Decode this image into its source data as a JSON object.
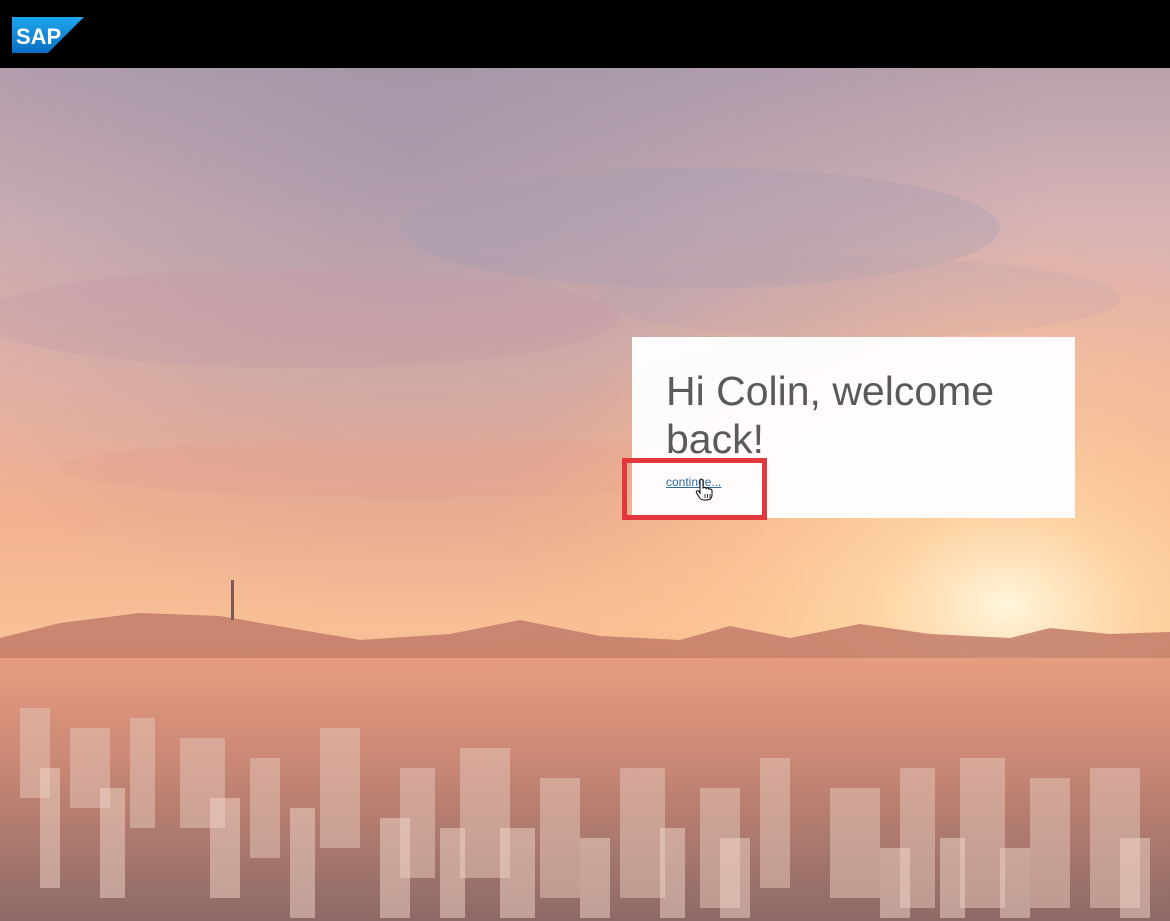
{
  "header": {
    "logo_text": "SAP",
    "logo_color": "#1a8de0",
    "background": "#000000"
  },
  "welcome": {
    "greeting": "Hi Colin, welcome back!",
    "continue_label": "continue..."
  },
  "annotation": {
    "highlight_color": "#e2383c"
  },
  "icons": {
    "cursor": "hand-pointer-icon"
  }
}
